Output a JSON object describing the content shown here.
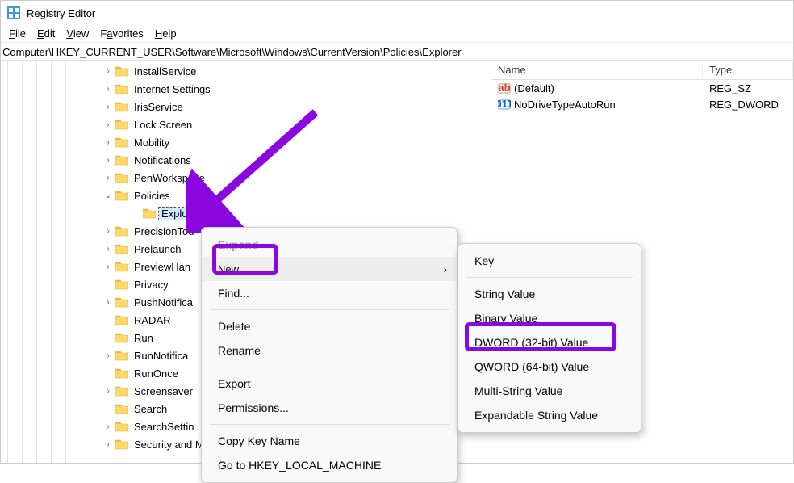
{
  "title": "Registry Editor",
  "menu": {
    "file": "File",
    "edit": "Edit",
    "view": "View",
    "favorites": "Favorites",
    "help": "Help"
  },
  "address": "Computer\\HKEY_CURRENT_USER\\Software\\Microsoft\\Windows\\CurrentVersion\\Policies\\Explorer",
  "tree": [
    {
      "label": "InstallService",
      "exp": ">"
    },
    {
      "label": "Internet Settings",
      "exp": ">"
    },
    {
      "label": "IrisService",
      "exp": ">"
    },
    {
      "label": "Lock Screen",
      "exp": ">"
    },
    {
      "label": "Mobility",
      "exp": ">"
    },
    {
      "label": "Notifications",
      "exp": ">"
    },
    {
      "label": "PenWorkspace",
      "exp": ">"
    },
    {
      "label": "Policies",
      "exp": "v",
      "sub": [
        {
          "label": "Explorer",
          "selected": true
        }
      ]
    },
    {
      "label": "PrecisionTou",
      "exp": ">"
    },
    {
      "label": "Prelaunch",
      "exp": ">"
    },
    {
      "label": "PreviewHan",
      "exp": ">"
    },
    {
      "label": "Privacy",
      "exp": ""
    },
    {
      "label": "PushNotifica",
      "exp": ">"
    },
    {
      "label": "RADAR",
      "exp": ""
    },
    {
      "label": "Run",
      "exp": ""
    },
    {
      "label": "RunNotifica",
      "exp": ">"
    },
    {
      "label": "RunOnce",
      "exp": ""
    },
    {
      "label": "Screensaver",
      "exp": ">"
    },
    {
      "label": "Search",
      "exp": ""
    },
    {
      "label": "SearchSettin",
      "exp": ">"
    },
    {
      "label": "Security and Maintenance",
      "exp": ">"
    }
  ],
  "list": {
    "cols": {
      "name": "Name",
      "type": "Type"
    },
    "rows": [
      {
        "name": "(Default)",
        "type": "REG_SZ",
        "icon": "str"
      },
      {
        "name": "NoDriveTypeAutoRun",
        "type": "REG_DWORD",
        "icon": "bin"
      }
    ]
  },
  "ctx1": {
    "expand": "Expand",
    "new": "New",
    "find": "Find...",
    "delete": "Delete",
    "rename": "Rename",
    "export": "Export",
    "perm": "Permissions...",
    "copy": "Copy Key Name",
    "goto": "Go to HKEY_LOCAL_MACHINE"
  },
  "ctx2": {
    "key": "Key",
    "str": "String Value",
    "bin": "Binary Value",
    "dword": "DWORD (32-bit) Value",
    "qword": "QWORD (64-bit) Value",
    "multi": "Multi-String Value",
    "expand": "Expandable String Value"
  }
}
